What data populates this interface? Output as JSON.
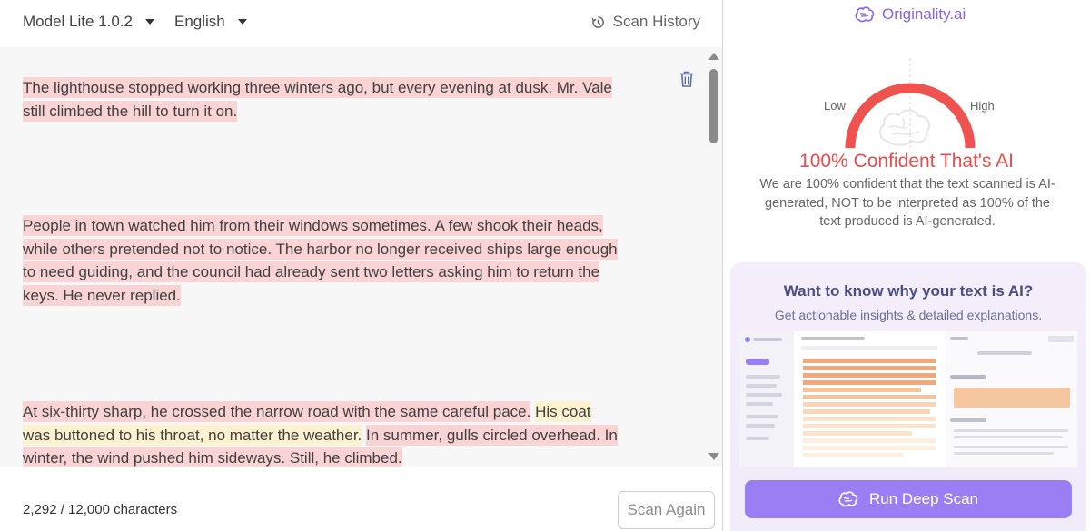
{
  "toolbar": {
    "model_label": "Model Lite 1.0.2",
    "language_label": "English",
    "history_label": "Scan History"
  },
  "editor": {
    "paragraphs": [
      {
        "segments": [
          {
            "text": "The lighthouse stopped working three winters ago, but every evening at dusk, Mr. Vale still climbed the hill to turn it on.",
            "highlight": "red"
          }
        ]
      },
      {
        "segments": [
          {
            "text": "People in town watched him from their windows sometimes. A few shook their heads, while others pretended not to notice. The harbor no longer received ships large enough to need guiding, and the council had already sent two letters asking him to return the keys. He never replied.",
            "highlight": "red"
          }
        ]
      },
      {
        "segments": [
          {
            "text": "At six-thirty sharp, he crossed the narrow road with the same careful pace.",
            "highlight": "red"
          },
          {
            "text": "His coat was buttoned to his throat, no matter the weather.",
            "highlight": "yellow"
          },
          {
            "text": "In summer, gulls circled overhead. In winter, the wind pushed him sideways. Still, he climbed.",
            "highlight": "red"
          }
        ]
      }
    ]
  },
  "footer": {
    "char_count": "2,292 / 12,000 characters",
    "scan_again_label": "Scan Again"
  },
  "result": {
    "brand": "Originality.ai",
    "low_label": "Low",
    "high_label": "High",
    "verdict": "100% Confident That's AI",
    "explanation": "We are 100% confident that the text scanned is AI-generated, NOT to be interpreted as 100% of the text produced is AI-generated.",
    "confidence_fraction": 1.0
  },
  "promo": {
    "title": "Want to know why your text is AI?",
    "subtitle": "Get actionable insights & detailed explanations.",
    "button_label": "Run Deep Scan"
  },
  "colors": {
    "accent": "#9a7ef3",
    "brand": "#8a63e8",
    "verdict": "#ee4a4a",
    "highlight_red": "#fad4d4",
    "highlight_yellow": "#fcf2d0"
  }
}
